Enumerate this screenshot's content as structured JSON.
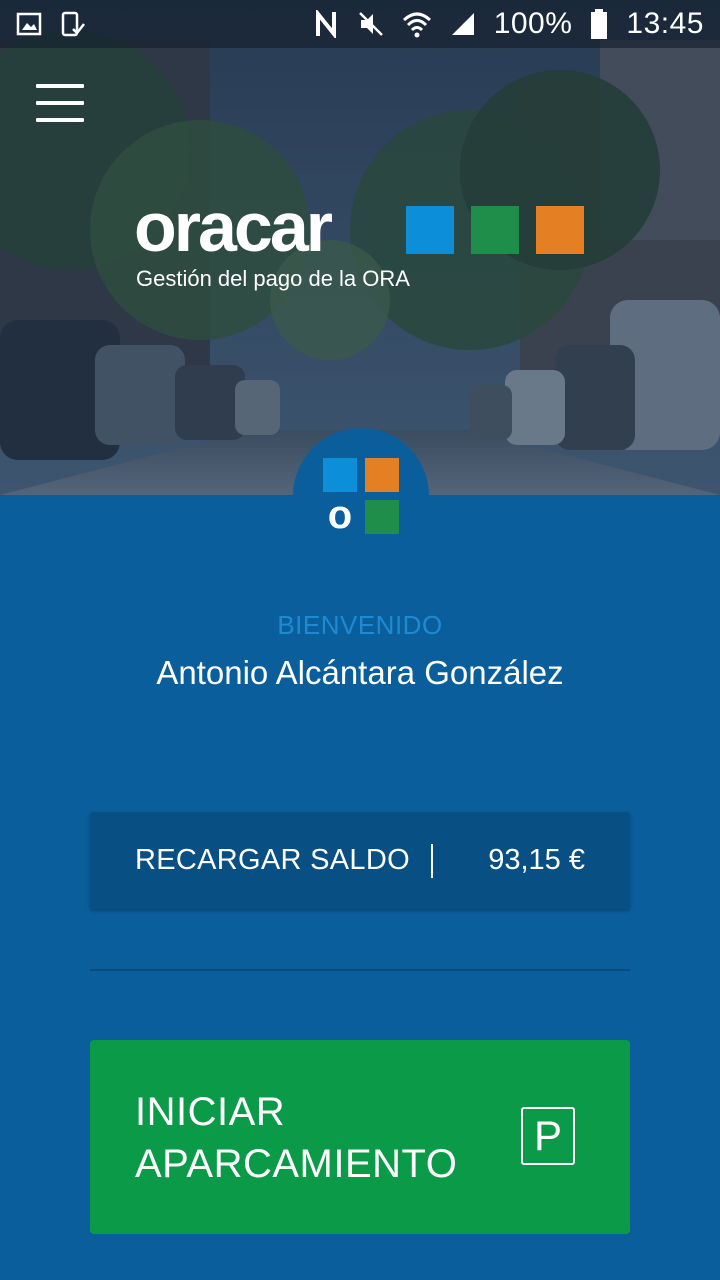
{
  "status_bar": {
    "battery": "100%",
    "time": "13:45",
    "icons_left": [
      "gallery-icon",
      "device-check-icon"
    ],
    "icons_right": [
      "nfc-icon",
      "mute-icon",
      "wifi-icon",
      "signal-icon",
      "battery-icon"
    ]
  },
  "header": {
    "menu_icon": "hamburger-menu-icon",
    "logo_text": "oracar",
    "tagline": "Gestión del pago de la ORA"
  },
  "colors": {
    "primary_blue": "#0a5e9b",
    "logo_blue": "#0c8fd8",
    "logo_green": "#1e8e4a",
    "logo_orange": "#e57f24",
    "action_green": "#0b9a47",
    "welcome_blue": "#1d8ad4"
  },
  "welcome": {
    "label": "BIENVENIDO",
    "user_name": "Antonio Alcántara González"
  },
  "balance": {
    "recharge_label": "RECARGAR SALDO",
    "amount": "93,15 €"
  },
  "parking": {
    "line1": "INICIAR",
    "line2": "APARCAMIENTO",
    "icon_letter": "P"
  }
}
